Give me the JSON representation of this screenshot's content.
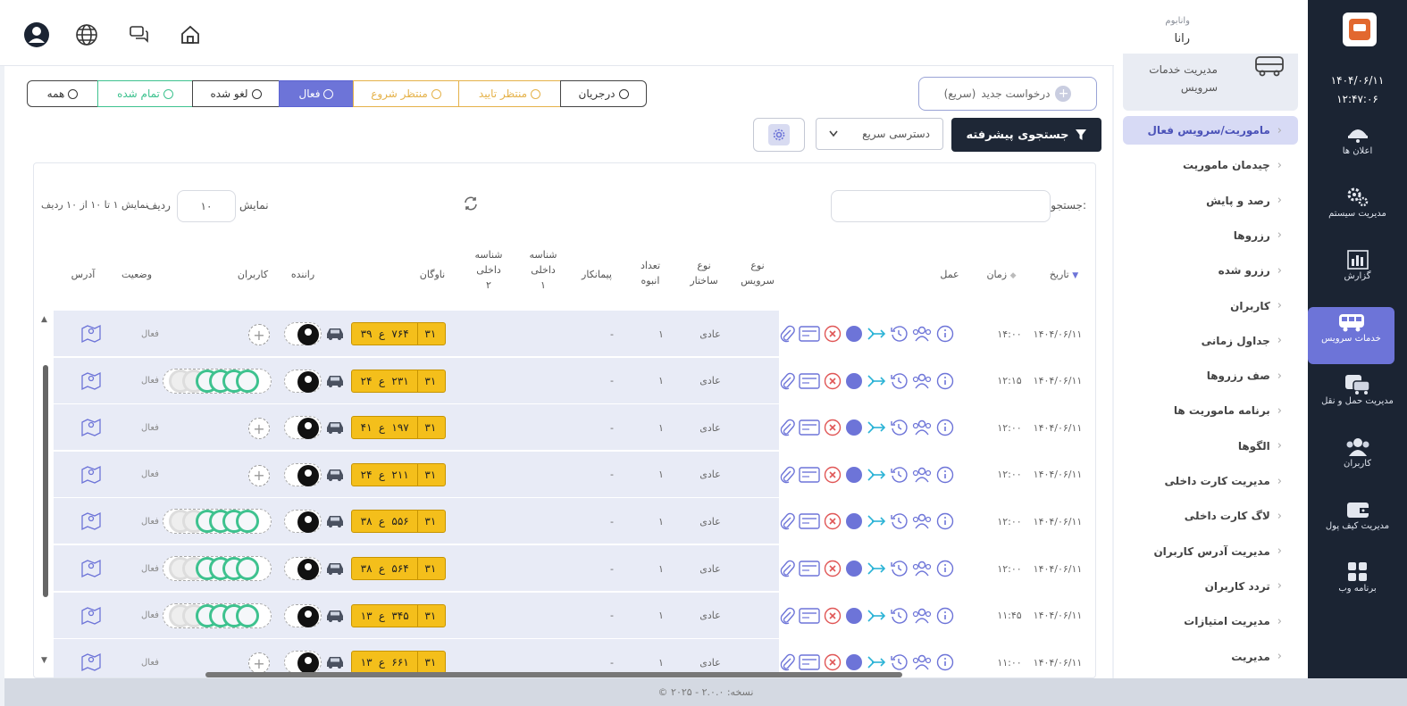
{
  "rail": {
    "datetime_date": "۱۴۰۴/۰۶/۱۱",
    "datetime_time": "۱۲:۴۷:۰۶",
    "items": [
      {
        "label": "اعلان ها",
        "icon": "announcement-icon"
      },
      {
        "label": "مدیریت سیستم",
        "icon": "gears-icon"
      },
      {
        "label": "گزارش",
        "icon": "report-chart-icon"
      },
      {
        "label": "خدمات سرویس",
        "icon": "bus-service-icon"
      },
      {
        "label": "مدیریت حمل و نقل",
        "icon": "transport-icon"
      },
      {
        "label": "کاربران",
        "icon": "users-icon"
      },
      {
        "label": "مدیریت کیف پول",
        "icon": "wallet-icon"
      },
      {
        "label": "برنامه وب",
        "icon": "web-app-icon"
      }
    ]
  },
  "header": {
    "org": "وانابوم",
    "user": "رانا"
  },
  "sidebar": {
    "card_title": "مدیریت خدمات سرویس",
    "items": [
      {
        "label": "ماموریت/سرویس فعال"
      },
      {
        "label": "چیدمان ماموریت"
      },
      {
        "label": "رصد و پایش"
      },
      {
        "label": "رزروها"
      },
      {
        "label": "رزرو شده"
      },
      {
        "label": "کاربران"
      },
      {
        "label": "جداول زمانی"
      },
      {
        "label": "صف رزروها"
      },
      {
        "label": "برنامه ماموریت ها"
      },
      {
        "label": "الگوها"
      },
      {
        "label": "مدیریت کارت داخلی"
      },
      {
        "label": "لاگ کارت داخلی"
      },
      {
        "label": "مدیریت آدرس کاربران"
      },
      {
        "label": "تردد کاربران"
      },
      {
        "label": "مدیریت امتیازات"
      },
      {
        "label": "مدیریت"
      }
    ]
  },
  "toolbar": {
    "new_request_label": "درخواست جدید",
    "new_request_hint": "(سریع)",
    "adv_search_label": "جستجوی پیشرفته",
    "quick_access_label": "دسترسی سریع"
  },
  "status_tabs": [
    {
      "label": "همه",
      "color": "#333333"
    },
    {
      "label": "تمام شده",
      "color": "#3ec28f"
    },
    {
      "label": "لغو شده",
      "color": "#333333"
    },
    {
      "label": "فعال",
      "color": "#ffffff"
    },
    {
      "label": "منتظر شروع",
      "color": "#e5b24a"
    },
    {
      "label": "منتظر تایید",
      "color": "#e5b24a"
    },
    {
      "label": "درجریان",
      "color": "#333333"
    }
  ],
  "table_controls": {
    "search_label": "جستجو:",
    "show_label": "نمایش",
    "page_length": "۱۰",
    "row_label": "ردیف",
    "info": "نمایش ۱ تا ۱۰ از ۱۰ ردیف"
  },
  "columns": {
    "date": "تاریخ",
    "time": "زمان",
    "action": "عمل",
    "service_type_1": "نوع",
    "service_type_2": "سرویس",
    "structure_1": "نوع",
    "structure_2": "ساختار",
    "count_1": "تعداد",
    "count_2": "انبوه",
    "contractor": "پیمانکار",
    "inner1_1": "شناسه",
    "inner1_2": "داخلی",
    "inner1_3": "۱",
    "inner2_1": "شناسه",
    "inner2_2": "داخلی",
    "inner2_3": "۲",
    "fleet": "ناوگان",
    "driver": "راننده",
    "users": "کاربران",
    "status": "وضعیت",
    "address": "آدرس"
  },
  "rows": [
    {
      "date": "۱۴۰۴/۰۶/۱۱",
      "time": "۱۴:۰۰",
      "type": "عادی",
      "count": "۱",
      "contractor": "-",
      "plate_a": "۳۱",
      "plate_b": "۷۶۴",
      "plate_c": "ع",
      "plate_d": "۳۹",
      "users": "add",
      "status": "فعال"
    },
    {
      "date": "۱۴۰۴/۰۶/۱۱",
      "time": "۱۲:۱۵",
      "type": "عادی",
      "count": "۱",
      "contractor": "-",
      "plate_a": "۳۱",
      "plate_b": "۲۳۱",
      "plate_c": "ع",
      "plate_d": "۲۴",
      "users": "group",
      "status": "فعال"
    },
    {
      "date": "۱۴۰۴/۰۶/۱۱",
      "time": "۱۲:۰۰",
      "type": "عادی",
      "count": "۱",
      "contractor": "-",
      "plate_a": "۳۱",
      "plate_b": "۱۹۷",
      "plate_c": "ع",
      "plate_d": "۴۱",
      "users": "add",
      "status": "فعال"
    },
    {
      "date": "۱۴۰۴/۰۶/۱۱",
      "time": "۱۲:۰۰",
      "type": "عادی",
      "count": "۱",
      "contractor": "-",
      "plate_a": "۳۱",
      "plate_b": "۲۱۱",
      "plate_c": "ع",
      "plate_d": "۲۴",
      "users": "add",
      "status": "فعال"
    },
    {
      "date": "۱۴۰۴/۰۶/۱۱",
      "time": "۱۲:۰۰",
      "type": "عادی",
      "count": "۱",
      "contractor": "-",
      "plate_a": "۳۱",
      "plate_b": "۵۵۶",
      "plate_c": "ع",
      "plate_d": "۳۸",
      "users": "group",
      "status": "فعال"
    },
    {
      "date": "۱۴۰۴/۰۶/۱۱",
      "time": "۱۲:۰۰",
      "type": "عادی",
      "count": "۱",
      "contractor": "-",
      "plate_a": "۳۱",
      "plate_b": "۵۶۴",
      "plate_c": "ع",
      "plate_d": "۳۸",
      "users": "group",
      "status": "فعال"
    },
    {
      "date": "۱۴۰۴/۰۶/۱۱",
      "time": "۱۱:۴۵",
      "type": "عادی",
      "count": "۱",
      "contractor": "-",
      "plate_a": "۳۱",
      "plate_b": "۳۴۵",
      "plate_c": "ع",
      "plate_d": "۱۳",
      "users": "group",
      "status": "فعال"
    },
    {
      "date": "۱۴۰۴/۰۶/۱۱",
      "time": "۱۱:۰۰",
      "type": "عادی",
      "count": "۱",
      "contractor": "-",
      "plate_a": "۳۱",
      "plate_b": "۶۶۱",
      "plate_c": "ع",
      "plate_d": "۱۳",
      "users": "add",
      "status": "فعال"
    }
  ],
  "footer": "© ۲۰۲۵ - نسخه: ۲.۰.۰",
  "colors": {
    "rail_bg": "#1b2433",
    "accent": "#6d74d8",
    "plate": "#f4bf1b",
    "success": "#3ec28f",
    "danger": "#e05656"
  }
}
